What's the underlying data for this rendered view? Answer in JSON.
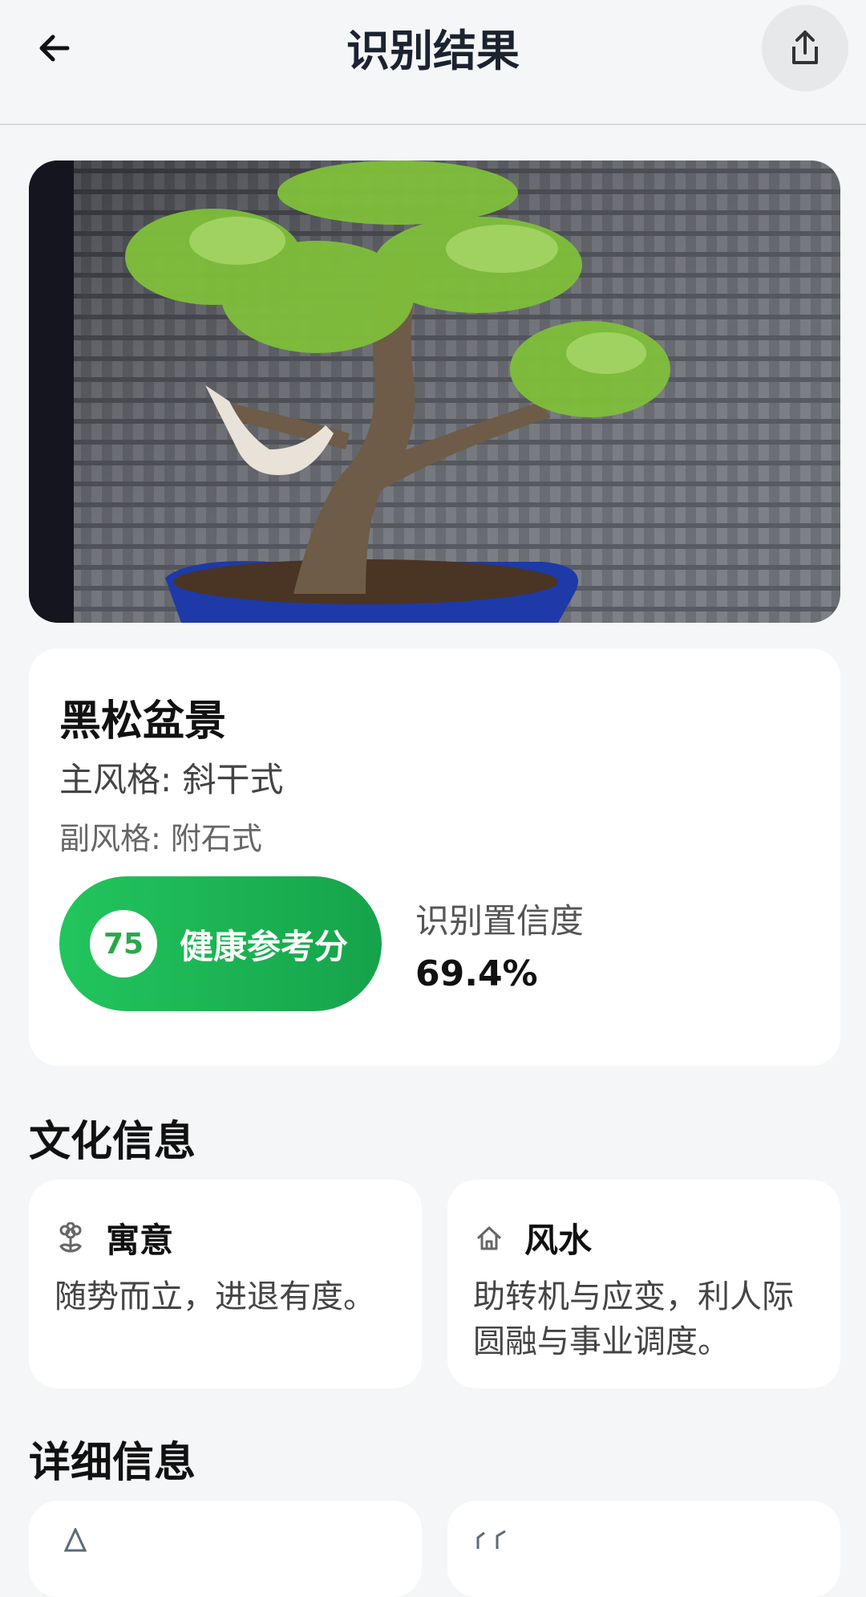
{
  "header": {
    "title": "识别结果",
    "back_icon": "arrow-left-icon",
    "share_icon": "share-icon"
  },
  "result": {
    "name": "黑松盆景",
    "main_style": "主风格: 斜干式",
    "sub_style": "副风格: 附石式",
    "health_score": "75",
    "health_label": "健康参考分",
    "confidence_label": "识别置信度",
    "confidence_value": "69.4%"
  },
  "culture": {
    "title": "文化信息",
    "cards": [
      {
        "icon": "flower-icon",
        "title": "寓意",
        "text": "随势而立，进退有度。"
      },
      {
        "icon": "home-icon",
        "title": "风水",
        "text": "助转机与应变，利人际圆融与事业调度。"
      }
    ]
  },
  "details": {
    "title": "详细信息"
  },
  "colors": {
    "accent_green": "#22c55e",
    "background": "#f4f6f8"
  }
}
